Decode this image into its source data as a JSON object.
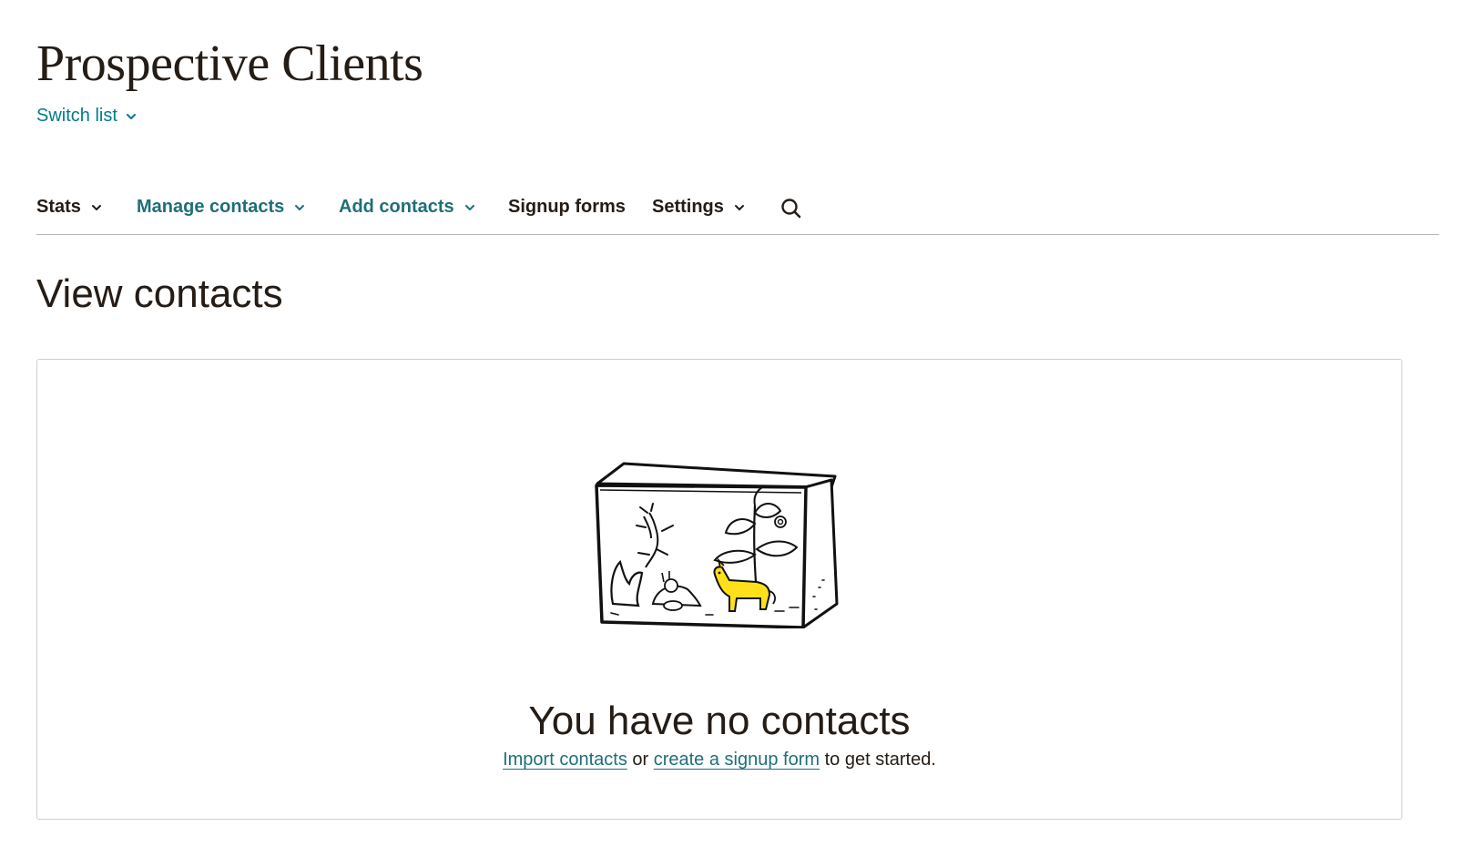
{
  "header": {
    "list_title": "Prospective Clients",
    "switch_list_label": "Switch list"
  },
  "nav": {
    "items": [
      {
        "label": "Stats",
        "has_dropdown": true
      },
      {
        "label": "Manage contacts",
        "has_dropdown": true
      },
      {
        "label": "Add contacts",
        "has_dropdown": true
      },
      {
        "label": "Signup forms",
        "has_dropdown": false
      },
      {
        "label": "Settings",
        "has_dropdown": true
      }
    ],
    "search_icon": "search-icon"
  },
  "main": {
    "section_title": "View contacts",
    "empty_state": {
      "illustration": "aquarium-illustration",
      "heading": "You have no contacts",
      "import_link": "Import contacts",
      "connector": " or ",
      "signup_link": "create a signup form",
      "suffix": " to get started."
    }
  },
  "colors": {
    "teal_link": "#1f6f78",
    "text_dark": "#241c15",
    "accent_yellow": "#ffe01b"
  }
}
